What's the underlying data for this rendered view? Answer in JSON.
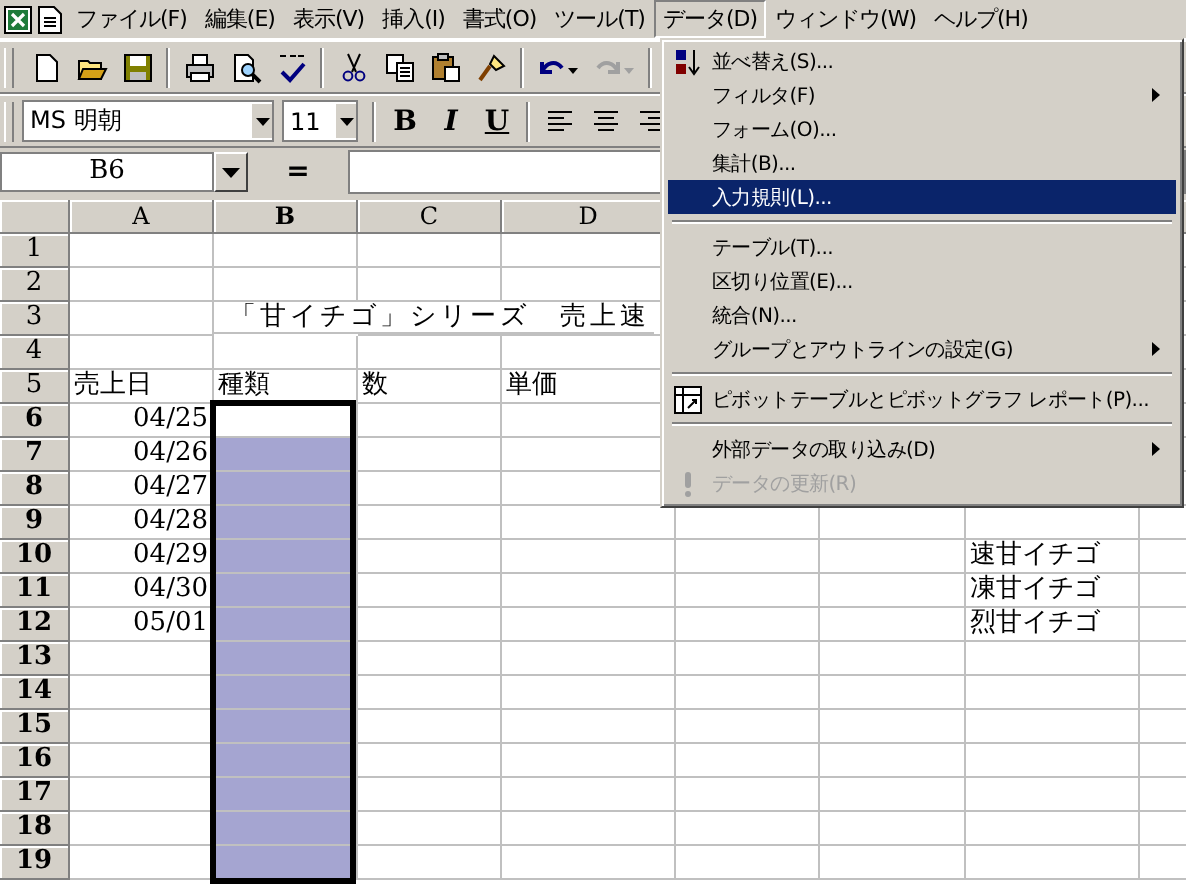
{
  "menu_bar": [
    {
      "label": "ファイル(F)",
      "selected": false
    },
    {
      "label": "編集(E)",
      "selected": false
    },
    {
      "label": "表示(V)",
      "selected": false
    },
    {
      "label": "挿入(I)",
      "selected": false
    },
    {
      "label": "書式(O)",
      "selected": false
    },
    {
      "label": "ツール(T)",
      "selected": false
    },
    {
      "label": "データ(D)",
      "selected": true
    },
    {
      "label": "ウィンドウ(W)",
      "selected": false
    },
    {
      "label": "ヘルプ(H)",
      "selected": false
    }
  ],
  "formatting": {
    "font": "MS 明朝",
    "size": "11",
    "bold": "B",
    "italic": "I",
    "underline": "U"
  },
  "formula_bar": {
    "name_box": "B6",
    "equals": "="
  },
  "sheet": {
    "columns": [
      {
        "label": "A",
        "selected": false
      },
      {
        "label": "B",
        "selected": true
      },
      {
        "label": "C",
        "selected": false
      },
      {
        "label": "D",
        "selected": false
      }
    ],
    "rows": [
      {
        "header": "1",
        "selected": false
      },
      {
        "header": "2",
        "selected": false
      },
      {
        "header": "3",
        "selected": false,
        "cells": {
          "b": {
            "kind": "title",
            "text": "「甘イチゴ」シリーズ　売上速"
          }
        }
      },
      {
        "header": "4",
        "selected": false
      },
      {
        "header": "5",
        "selected": false,
        "cells": {
          "a": {
            "kind": "text",
            "text": "売上日"
          },
          "b": {
            "kind": "text",
            "text": "種類"
          },
          "c": {
            "kind": "text",
            "text": "数"
          },
          "d": {
            "kind": "text",
            "text": "単価"
          }
        }
      },
      {
        "header": "6",
        "selected": true,
        "cells": {
          "a": {
            "kind": "date",
            "text": "04/25"
          }
        }
      },
      {
        "header": "7",
        "selected": true,
        "cells": {
          "a": {
            "kind": "date",
            "text": "04/26"
          }
        }
      },
      {
        "header": "8",
        "selected": true,
        "cells": {
          "a": {
            "kind": "date",
            "text": "04/27"
          }
        }
      },
      {
        "header": "9",
        "selected": true,
        "cells": {
          "a": {
            "kind": "date",
            "text": "04/28"
          }
        }
      },
      {
        "header": "10",
        "selected": true,
        "cells": {
          "a": {
            "kind": "date",
            "text": "04/29"
          },
          "g": {
            "kind": "text",
            "text": "速甘イチゴ"
          }
        }
      },
      {
        "header": "11",
        "selected": true,
        "cells": {
          "a": {
            "kind": "date",
            "text": "04/30"
          },
          "g": {
            "kind": "text",
            "text": "凍甘イチゴ"
          }
        }
      },
      {
        "header": "12",
        "selected": true,
        "cells": {
          "a": {
            "kind": "date",
            "text": "05/01"
          },
          "g": {
            "kind": "text",
            "text": "烈甘イチゴ"
          }
        }
      },
      {
        "header": "13",
        "selected": true
      },
      {
        "header": "14",
        "selected": true
      },
      {
        "header": "15",
        "selected": true
      },
      {
        "header": "16",
        "selected": true
      },
      {
        "header": "17",
        "selected": true
      },
      {
        "header": "18",
        "selected": true
      },
      {
        "header": "19",
        "selected": true
      }
    ]
  },
  "data_menu": [
    {
      "kind": "sort",
      "label": "並べ替え(S)...",
      "submenu": false,
      "selected": false,
      "disabled": false
    },
    {
      "kind": "plain",
      "label": "フィルタ(F)",
      "submenu": true,
      "selected": false,
      "disabled": false
    },
    {
      "kind": "plain",
      "label": "フォーム(O)...",
      "submenu": false,
      "selected": false,
      "disabled": false
    },
    {
      "kind": "plain",
      "label": "集計(B)...",
      "submenu": false,
      "selected": false,
      "disabled": false
    },
    {
      "kind": "plain",
      "label": "入力規則(L)...",
      "submenu": false,
      "selected": true,
      "disabled": false
    },
    {
      "kind": "separator"
    },
    {
      "kind": "plain",
      "label": "テーブル(T)...",
      "submenu": false,
      "selected": false,
      "disabled": false
    },
    {
      "kind": "plain",
      "label": "区切り位置(E)...",
      "submenu": false,
      "selected": false,
      "disabled": false
    },
    {
      "kind": "plain",
      "label": "統合(N)...",
      "submenu": false,
      "selected": false,
      "disabled": false
    },
    {
      "kind": "plain",
      "label": "グループとアウトラインの設定(G)",
      "submenu": true,
      "selected": false,
      "disabled": false
    },
    {
      "kind": "separator"
    },
    {
      "kind": "pivot",
      "label": "ピボットテーブルとピボットグラフ レポート(P)...",
      "submenu": false,
      "selected": false,
      "disabled": false
    },
    {
      "kind": "separator"
    },
    {
      "kind": "plain",
      "label": "外部データの取り込み(D)",
      "submenu": true,
      "selected": false,
      "disabled": false
    },
    {
      "kind": "refresh",
      "label": "データの更新(R)",
      "submenu": false,
      "selected": false,
      "disabled": true
    }
  ]
}
